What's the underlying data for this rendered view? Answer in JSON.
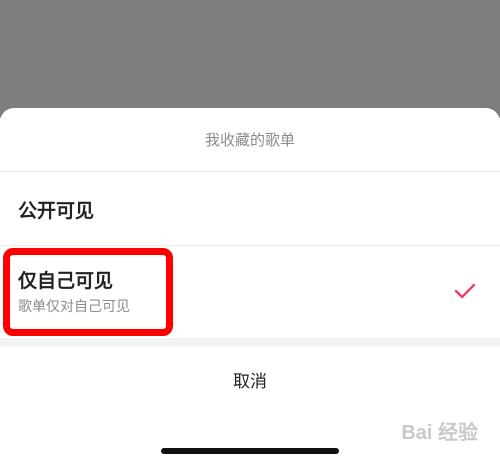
{
  "sheet": {
    "title": "我收藏的歌单",
    "options": [
      {
        "label": "公开可见"
      },
      {
        "label": "仅自己可见",
        "sublabel": "歌单仅对自己可见",
        "selected": true
      }
    ],
    "cancel_label": "取消"
  },
  "watermark": "Bai 经验",
  "colors": {
    "backdrop": "#7d7e80",
    "check": "#e8416a",
    "highlight": "#ff0000"
  },
  "icons": {
    "check": "check-icon"
  }
}
